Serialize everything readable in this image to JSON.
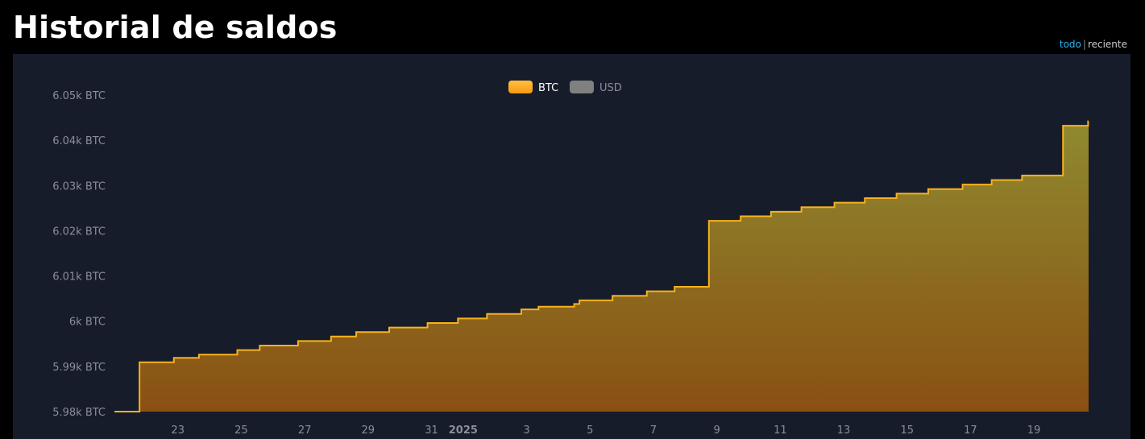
{
  "header": {
    "title": "Historial de saldos"
  },
  "range_toggle": {
    "all_label": "todo",
    "separator": "|",
    "recent_label": "reciente"
  },
  "colors": {
    "btc": "#f5a623",
    "btc_line": "#f7b21c",
    "usd": "#808080",
    "background": "#171c2b",
    "page": "#000000",
    "link": "#29b6f6"
  },
  "chart_data": {
    "type": "area",
    "title": "Historial de saldos",
    "step": true,
    "legend": {
      "position": "top-center",
      "items": [
        {
          "label": "BTC",
          "color": "#f5a623",
          "active": true
        },
        {
          "label": "USD",
          "color": "#808080",
          "active": false
        }
      ]
    },
    "y_unit": "BTC",
    "ylim": [
      5980,
      6050
    ],
    "y_ticks": [
      {
        "value": 5980,
        "label": "5.98k BTC"
      },
      {
        "value": 5990,
        "label": "5.99k BTC"
      },
      {
        "value": 6000,
        "label": "6k BTC"
      },
      {
        "value": 6010,
        "label": "6.01k BTC"
      },
      {
        "value": 6020,
        "label": "6.02k BTC"
      },
      {
        "value": 6030,
        "label": "6.03k BTC"
      },
      {
        "value": 6040,
        "label": "6.04k BTC"
      },
      {
        "value": 6050,
        "label": "6.05k BTC"
      }
    ],
    "xlim": [
      "2024-12-21",
      "2025-01-20T18:00"
    ],
    "x_ticks": [
      {
        "date": "2024-12-23",
        "label": "23",
        "bold": false
      },
      {
        "date": "2024-12-25",
        "label": "25",
        "bold": false
      },
      {
        "date": "2024-12-27",
        "label": "27",
        "bold": false
      },
      {
        "date": "2024-12-29",
        "label": "29",
        "bold": false
      },
      {
        "date": "2024-12-31",
        "label": "31",
        "bold": false
      },
      {
        "date": "2025-01-01",
        "label": "2025",
        "bold": true
      },
      {
        "date": "2025-01-03",
        "label": "3",
        "bold": false
      },
      {
        "date": "2025-01-05",
        "label": "5",
        "bold": false
      },
      {
        "date": "2025-01-07",
        "label": "7",
        "bold": false
      },
      {
        "date": "2025-01-09",
        "label": "9",
        "bold": false
      },
      {
        "date": "2025-01-11",
        "label": "11",
        "bold": false
      },
      {
        "date": "2025-01-13",
        "label": "13",
        "bold": false
      },
      {
        "date": "2025-01-15",
        "label": "15",
        "bold": false
      },
      {
        "date": "2025-01-17",
        "label": "17",
        "bold": false
      },
      {
        "date": "2025-01-19",
        "label": "19",
        "bold": false
      }
    ],
    "series": [
      {
        "name": "BTC",
        "points": [
          {
            "x": "2024-12-21T12:00",
            "y": 5980.0
          },
          {
            "x": "2024-12-21T19:00",
            "y": 5990.9
          },
          {
            "x": "2024-12-22T21:00",
            "y": 5991.9
          },
          {
            "x": "2024-12-23T16:00",
            "y": 5992.6
          },
          {
            "x": "2024-12-24T21:00",
            "y": 5993.6
          },
          {
            "x": "2024-12-25T14:00",
            "y": 5994.6
          },
          {
            "x": "2024-12-26T19:00",
            "y": 5995.6
          },
          {
            "x": "2024-12-27T20:00",
            "y": 5996.6
          },
          {
            "x": "2024-12-28T15:00",
            "y": 5997.6
          },
          {
            "x": "2024-12-29T16:00",
            "y": 5998.6
          },
          {
            "x": "2024-12-30T21:00",
            "y": 5999.6
          },
          {
            "x": "2024-12-31T20:00",
            "y": 6000.6
          },
          {
            "x": "2025-01-01T18:00",
            "y": 6001.6
          },
          {
            "x": "2025-01-02T20:00",
            "y": 6002.6
          },
          {
            "x": "2025-01-03T09:00",
            "y": 6003.2
          },
          {
            "x": "2025-01-04T12:00",
            "y": 6003.8
          },
          {
            "x": "2025-01-04T16:00",
            "y": 6004.6
          },
          {
            "x": "2025-01-05T17:00",
            "y": 6005.6
          },
          {
            "x": "2025-01-06T19:00",
            "y": 6006.6
          },
          {
            "x": "2025-01-07T16:00",
            "y": 6007.6
          },
          {
            "x": "2025-01-08T18:00",
            "y": 6022.2
          },
          {
            "x": "2025-01-09T18:00",
            "y": 6023.2
          },
          {
            "x": "2025-01-10T17:00",
            "y": 6024.2
          },
          {
            "x": "2025-01-11T16:00",
            "y": 6025.2
          },
          {
            "x": "2025-01-12T17:00",
            "y": 6026.2
          },
          {
            "x": "2025-01-13T16:00",
            "y": 6027.2
          },
          {
            "x": "2025-01-14T16:00",
            "y": 6028.2
          },
          {
            "x": "2025-01-15T16:00",
            "y": 6029.2
          },
          {
            "x": "2025-01-16T18:00",
            "y": 6030.2
          },
          {
            "x": "2025-01-17T16:00",
            "y": 6031.2
          },
          {
            "x": "2025-01-18T15:00",
            "y": 6032.2
          },
          {
            "x": "2025-01-19T22:00",
            "y": 6043.2
          },
          {
            "x": "2025-01-20T17:00",
            "y": 6044.2
          }
        ]
      }
    ]
  }
}
